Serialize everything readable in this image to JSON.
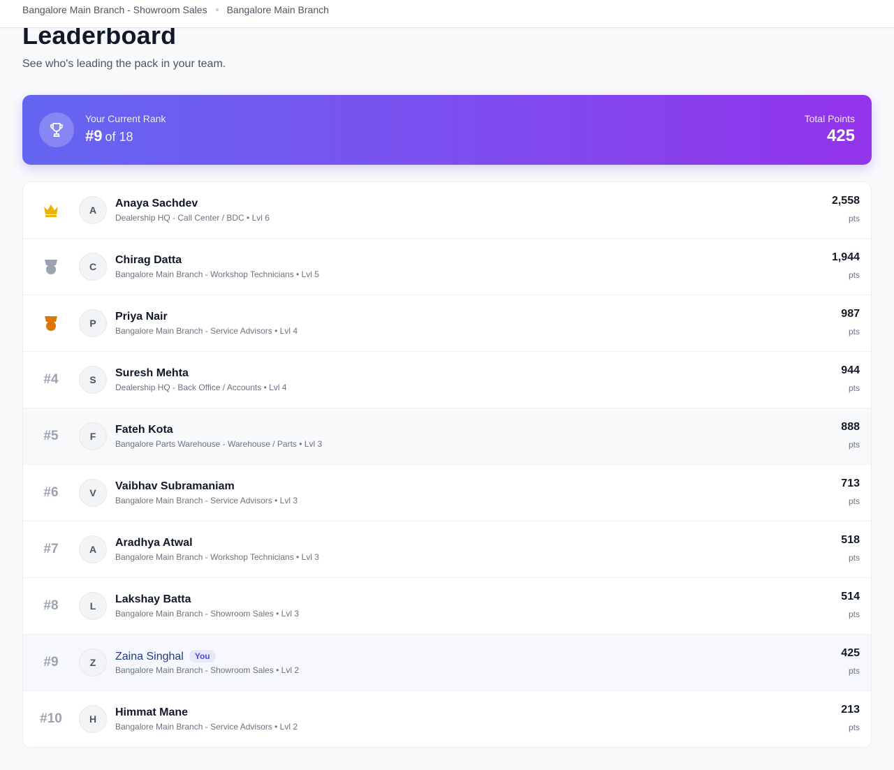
{
  "breadcrumb": {
    "items": [
      "Bangalore Main Branch - Showroom Sales",
      "Bangalore Main Branch"
    ]
  },
  "header": {
    "title": "Leaderboard",
    "subtitle": "See who's leading the pack in your team."
  },
  "rank_card": {
    "icon": "trophy-icon",
    "label": "Your Current Rank",
    "rank": "#9",
    "of_text": "of 18",
    "points_label": "Total Points",
    "points": "425",
    "colors": {
      "gradient_start": "#6366f1",
      "gradient_end": "#9333ea"
    }
  },
  "leaderboard": {
    "pts_unit": "pts",
    "you_badge": "You",
    "medal_colors": {
      "gold": "#eab308",
      "silver": "#9ca3af",
      "bronze": "#d97706"
    },
    "rows": [
      {
        "rank": "#1",
        "medal": "crown-icon",
        "initial": "A",
        "name": "Anaya Sachdev",
        "meta": "Dealership HQ - Call Center / BDC • Lvl 6",
        "points": "2,558"
      },
      {
        "rank": "#2",
        "medal": "silver-medal-icon",
        "initial": "C",
        "name": "Chirag Datta",
        "meta": "Bangalore Main Branch - Workshop Technicians • Lvl 5",
        "points": "1,944"
      },
      {
        "rank": "#3",
        "medal": "bronze-medal-icon",
        "initial": "P",
        "name": "Priya Nair",
        "meta": "Bangalore Main Branch - Service Advisors • Lvl 4",
        "points": "987"
      },
      {
        "rank": "#4",
        "initial": "S",
        "name": "Suresh Mehta",
        "meta": "Dealership HQ - Back Office / Accounts • Lvl 4",
        "points": "944"
      },
      {
        "rank": "#5",
        "initial": "F",
        "name": "Fateh Kota",
        "meta": "Bangalore Parts Warehouse - Warehouse / Parts • Lvl 3",
        "points": "888"
      },
      {
        "rank": "#6",
        "initial": "V",
        "name": "Vaibhav Subramaniam",
        "meta": "Bangalore Main Branch - Service Advisors • Lvl 3",
        "points": "713"
      },
      {
        "rank": "#7",
        "initial": "A",
        "name": "Aradhya Atwal",
        "meta": "Bangalore Main Branch - Workshop Technicians • Lvl 3",
        "points": "518"
      },
      {
        "rank": "#8",
        "initial": "L",
        "name": "Lakshay Batta",
        "meta": "Bangalore Main Branch - Showroom Sales • Lvl 3",
        "points": "514"
      },
      {
        "rank": "#9",
        "initial": "Z",
        "name": "Zaina Singhal",
        "meta": "Bangalore Main Branch - Showroom Sales • Lvl 2",
        "points": "425",
        "is_me": true
      },
      {
        "rank": "#10",
        "initial": "H",
        "name": "Himmat Mane",
        "meta": "Bangalore Main Branch - Service Advisors • Lvl 2",
        "points": "213"
      }
    ]
  }
}
